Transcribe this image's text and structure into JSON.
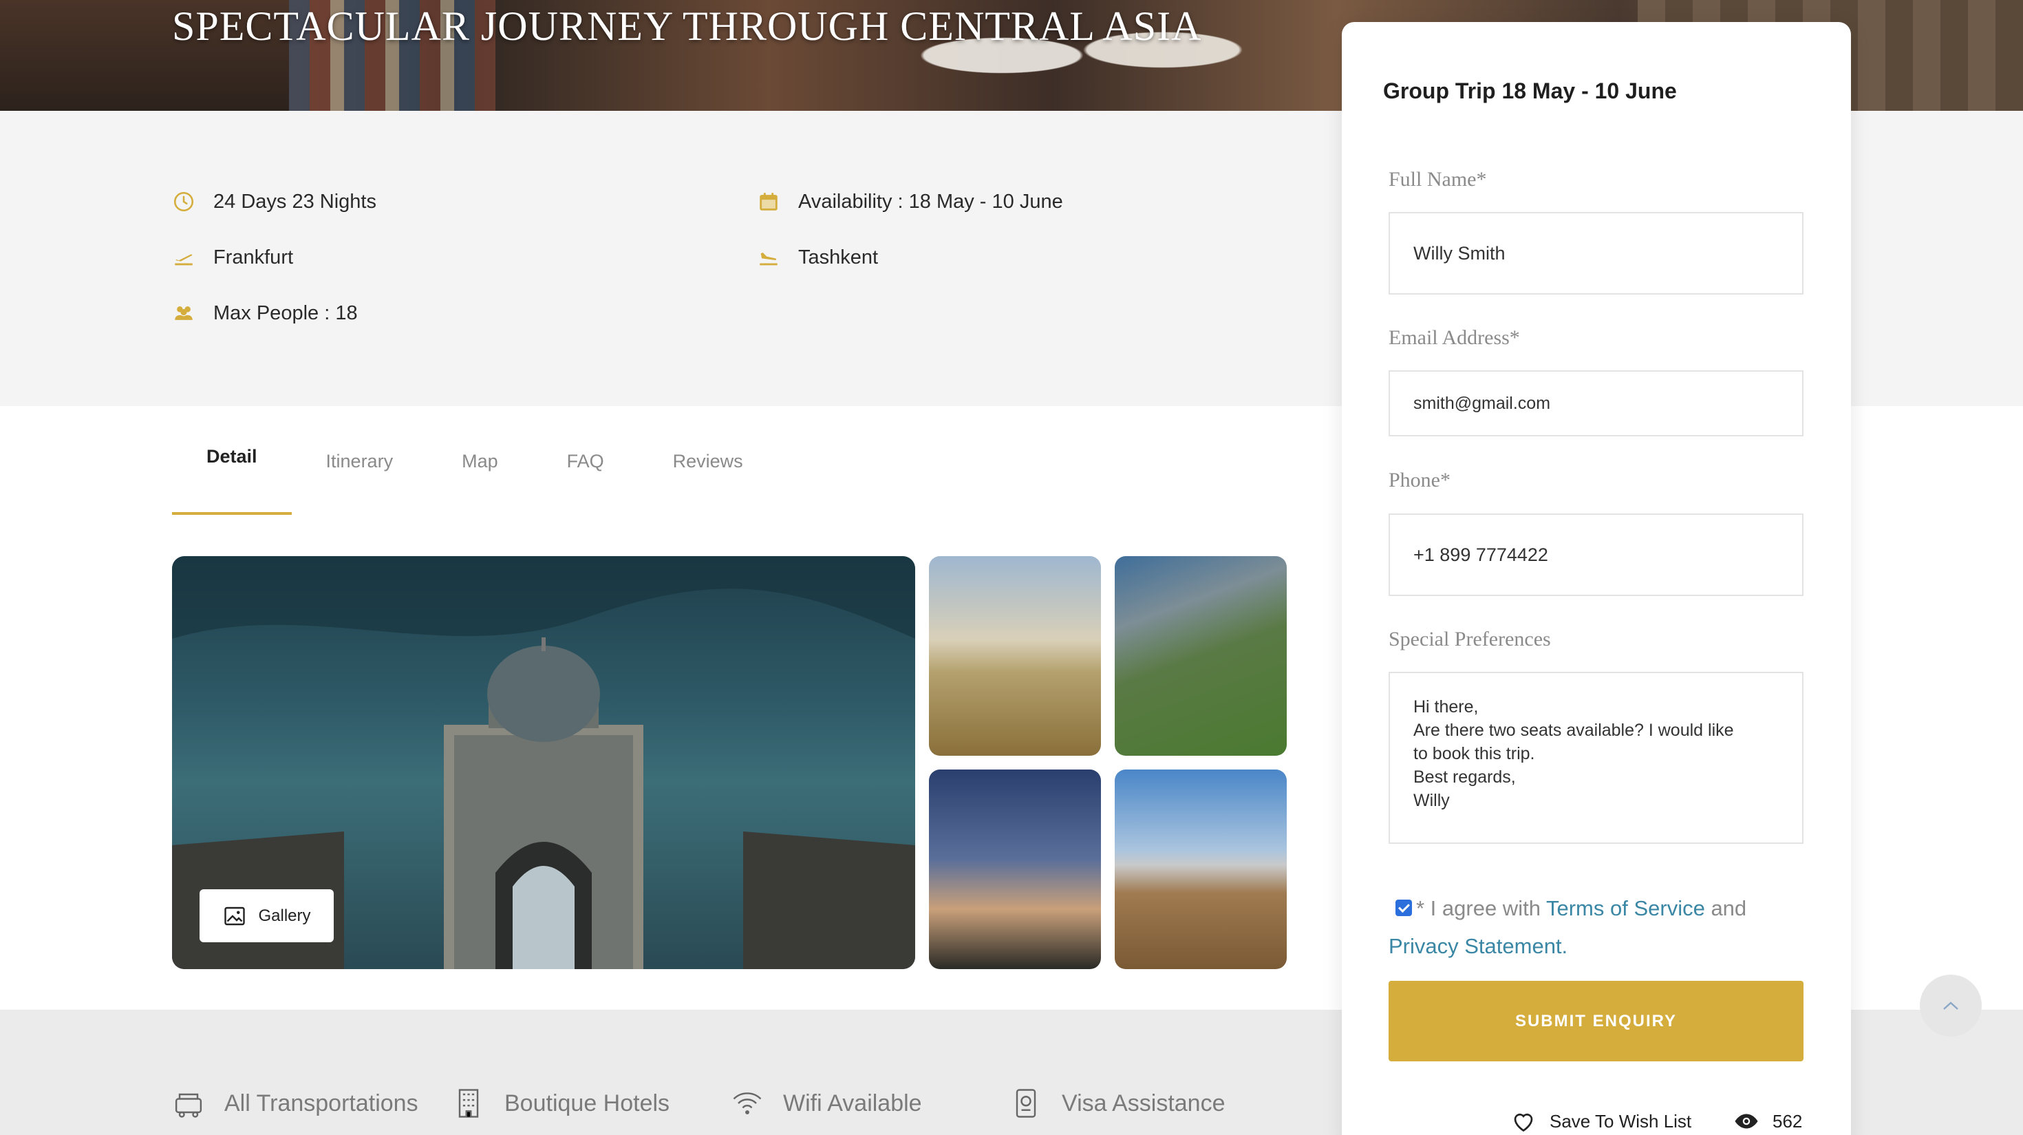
{
  "hero": {
    "title": "SPECTACULAR JOURNEY THROUGH CENTRAL ASIA"
  },
  "info": {
    "duration": "24 Days 23 Nights",
    "departure": "Frankfurt",
    "max_people": "Max People : 18",
    "availability": "Availability : 18 May - 10 June",
    "arrival": "Tashkent"
  },
  "tabs": [
    {
      "label": "Detail",
      "active": true
    },
    {
      "label": "Itinerary",
      "active": false
    },
    {
      "label": "Map",
      "active": false
    },
    {
      "label": "FAQ",
      "active": false
    },
    {
      "label": "Reviews",
      "active": false
    }
  ],
  "gallery": {
    "button_label": "Gallery"
  },
  "features": [
    {
      "label": "All Transportations",
      "icon": "bus-icon"
    },
    {
      "label": "Boutique Hotels",
      "icon": "hotel-icon"
    },
    {
      "label": "Wifi Available",
      "icon": "wifi-icon"
    },
    {
      "label": "Visa Assistance",
      "icon": "passport-icon"
    }
  ],
  "form": {
    "title": "Group Trip 18 May - 10 June",
    "full_name_label": "Full Name*",
    "full_name_value": "Willy Smith",
    "email_label": "Email Address*",
    "email_value": "smith@gmail.com",
    "phone_label": "Phone*",
    "phone_value": "+1 899 7774422",
    "prefs_label": "Special Preferences",
    "prefs_value": "Hi there,\nAre there two seats available? I would like\nto book this trip.\nBest regards,\nWilly",
    "agree_prefix": "* I agree with ",
    "terms_link": "Terms of Service",
    "agree_and": " and",
    "privacy_link": "Privacy Statement.",
    "agree_checked": true,
    "submit_label": "SUBMIT ENQUIRY",
    "wishlist_label": "Save To Wish List",
    "views": "562"
  },
  "colors": {
    "accent": "#d4ad3c",
    "link": "#3a86a5",
    "info_bg": "#f4f4f4"
  }
}
